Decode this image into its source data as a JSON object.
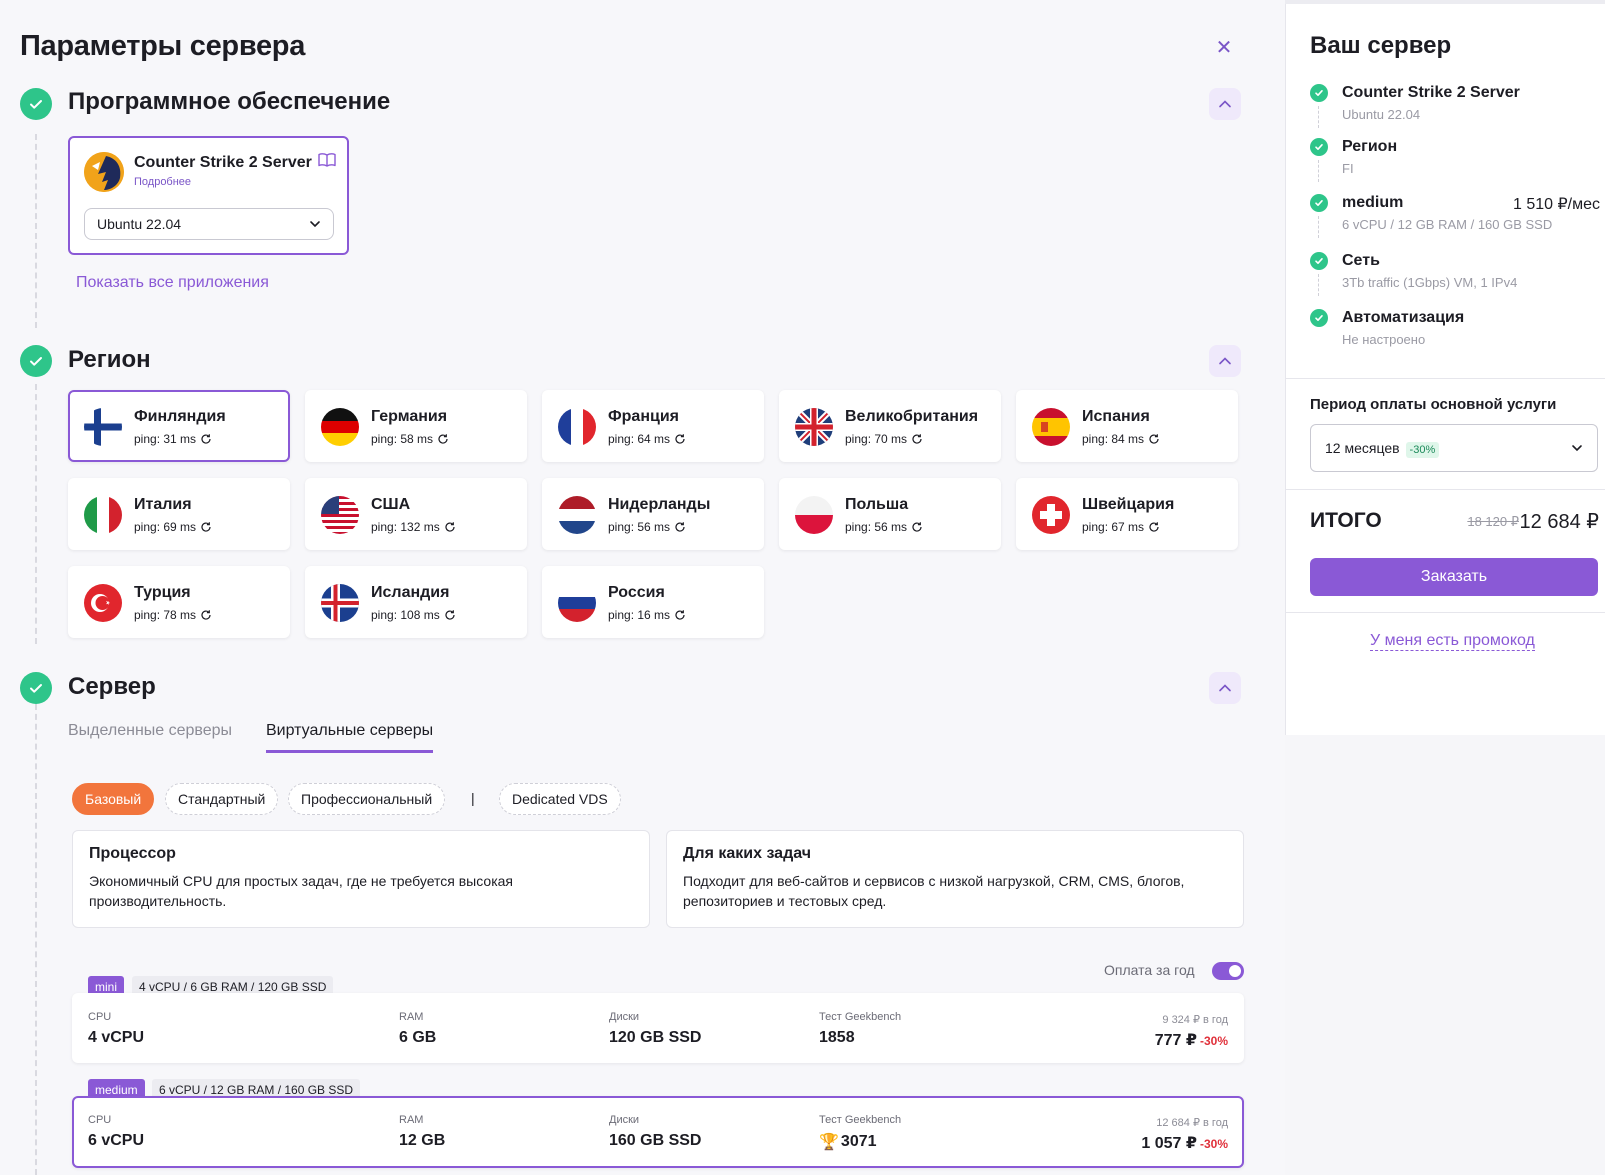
{
  "page_title": "Параметры сервера",
  "sections": {
    "software": {
      "title": "Программное обеспечение",
      "app_name": "Counter Strike 2 Server",
      "more_link": "Подробнее",
      "os_selected": "Ubuntu 22.04",
      "show_all": "Показать все приложения"
    },
    "region": {
      "title": "Регион",
      "items": [
        {
          "name": "Финляндия",
          "ping": "ping: 31 ms",
          "flag": "fi"
        },
        {
          "name": "Германия",
          "ping": "ping: 58 ms",
          "flag": "de"
        },
        {
          "name": "Франция",
          "ping": "ping: 64 ms",
          "flag": "fr"
        },
        {
          "name": "Великобритания",
          "ping": "ping: 70 ms",
          "flag": "gb"
        },
        {
          "name": "Испания",
          "ping": "ping: 84 ms",
          "flag": "es"
        },
        {
          "name": "Италия",
          "ping": "ping: 69 ms",
          "flag": "it"
        },
        {
          "name": "США",
          "ping": "ping: 132 ms",
          "flag": "us"
        },
        {
          "name": "Нидерланды",
          "ping": "ping: 56 ms",
          "flag": "nl"
        },
        {
          "name": "Польша",
          "ping": "ping: 56 ms",
          "flag": "pl"
        },
        {
          "name": "Швейцария",
          "ping": "ping: 67 ms",
          "flag": "ch"
        },
        {
          "name": "Турция",
          "ping": "ping: 78 ms",
          "flag": "tr"
        },
        {
          "name": "Исландия",
          "ping": "ping: 108 ms",
          "flag": "is"
        },
        {
          "name": "Россия",
          "ping": "ping: 16 ms",
          "flag": "ru"
        }
      ],
      "selected": "Финляндия"
    },
    "server": {
      "title": "Сервер",
      "tabs": [
        "Выделенные серверы",
        "Виртуальные серверы"
      ],
      "active_tab": "Виртуальные серверы",
      "pills": [
        "Базовый",
        "Стандартный",
        "Профессиональный",
        "Dedicated VDS"
      ],
      "pill_separator": "|",
      "active_pill": "Базовый",
      "info": [
        {
          "title": "Процессор",
          "text": "Экономичный CPU для простых задач, где не требуется высокая производительность."
        },
        {
          "title": "Для каких задач",
          "text": "Подходит для веб-сайтов и сервисов с низкой нагрузкой, CRM, CMS, блогов, репозиториев и тестовых сред."
        }
      ],
      "yearly_label": "Оплата за год",
      "yearly_on": true,
      "col_labels": {
        "cpu": "CPU",
        "ram": "RAM",
        "disk": "Диски",
        "bench": "Тест Geekbench"
      },
      "plans": [
        {
          "name": "mini",
          "spec": "4 vCPU / 6 GB RAM / 120 GB SSD",
          "cpu": "4 vCPU",
          "ram": "6 GB",
          "disk": "120 GB SSD",
          "bench": "1858",
          "year_price": "9 324 ₽ в год",
          "month_price": "777 ₽",
          "discount": "-30%",
          "trophy": false
        },
        {
          "name": "medium",
          "spec": "6 vCPU / 12 GB RAM / 160 GB SSD",
          "cpu": "6 vCPU",
          "ram": "12 GB",
          "disk": "160 GB SSD",
          "bench": "3071",
          "year_price": "12 684 ₽ в год",
          "month_price": "1 057 ₽",
          "discount": "-30%",
          "trophy": true
        }
      ],
      "selected_plan": "medium"
    }
  },
  "summary": {
    "title": "Ваш сервер",
    "items": [
      {
        "name": "Counter Strike 2 Server",
        "sub": "Ubuntu 22.04",
        "price": ""
      },
      {
        "name": "Регион",
        "sub": "FI",
        "price": ""
      },
      {
        "name": "medium",
        "sub": "6 vCPU / 12 GB RAM / 160 GB SSD",
        "price": "1 510 ₽/мес"
      },
      {
        "name": "Сеть",
        "sub": "3Tb traffic (1Gbps) VM, 1 IPv4",
        "price": ""
      },
      {
        "name": "Автоматизация",
        "sub": "Не настроено",
        "price": ""
      }
    ],
    "period_label": "Период оплаты основной услуги",
    "period_value": "12 месяцев",
    "period_discount": "-30%",
    "total_label": "ИТОГО",
    "total_old": "18 120 ₽",
    "total_new": "12 684 ₽",
    "order_button": "Заказать",
    "promo_link": "У меня есть промокод"
  },
  "colors": {
    "accent": "#8a59d6",
    "success": "#2ec58a",
    "orange": "#f2753c",
    "danger": "#e0303a"
  }
}
